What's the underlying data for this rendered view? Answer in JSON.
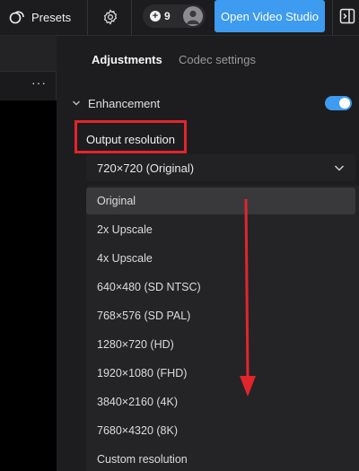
{
  "topbar": {
    "presets_label": "Presets",
    "credits_count": "9",
    "open_studio_label": "Open Video Studio"
  },
  "left_pane": {
    "more_label": "···"
  },
  "tabs": [
    {
      "label": "Adjustments",
      "active": true
    },
    {
      "label": "Codec settings",
      "active": false
    }
  ],
  "enhancement": {
    "title": "Enhancement",
    "enabled": true
  },
  "output_resolution": {
    "label": "Output resolution",
    "selected_value": "720×720 (Original)",
    "options": [
      "Original",
      "2x Upscale",
      "4x Upscale",
      "640×480 (SD NTSC)",
      "768×576 (SD PAL)",
      "1280×720 (HD)",
      "1920×1080 (FHD)",
      "3840×2160 (4K)",
      "7680×4320 (8K)",
      "Custom resolution"
    ],
    "highlighted_option": "Original"
  },
  "colors": {
    "accent": "#3d9bf0",
    "annotation": "#e3242b",
    "background": "#1d1d1f"
  },
  "icons": [
    "presets-icon",
    "gear-icon",
    "plus-icon",
    "avatar-icon",
    "panel-toggle-icon",
    "chevron-right-icon",
    "chevron-down-icon"
  ]
}
